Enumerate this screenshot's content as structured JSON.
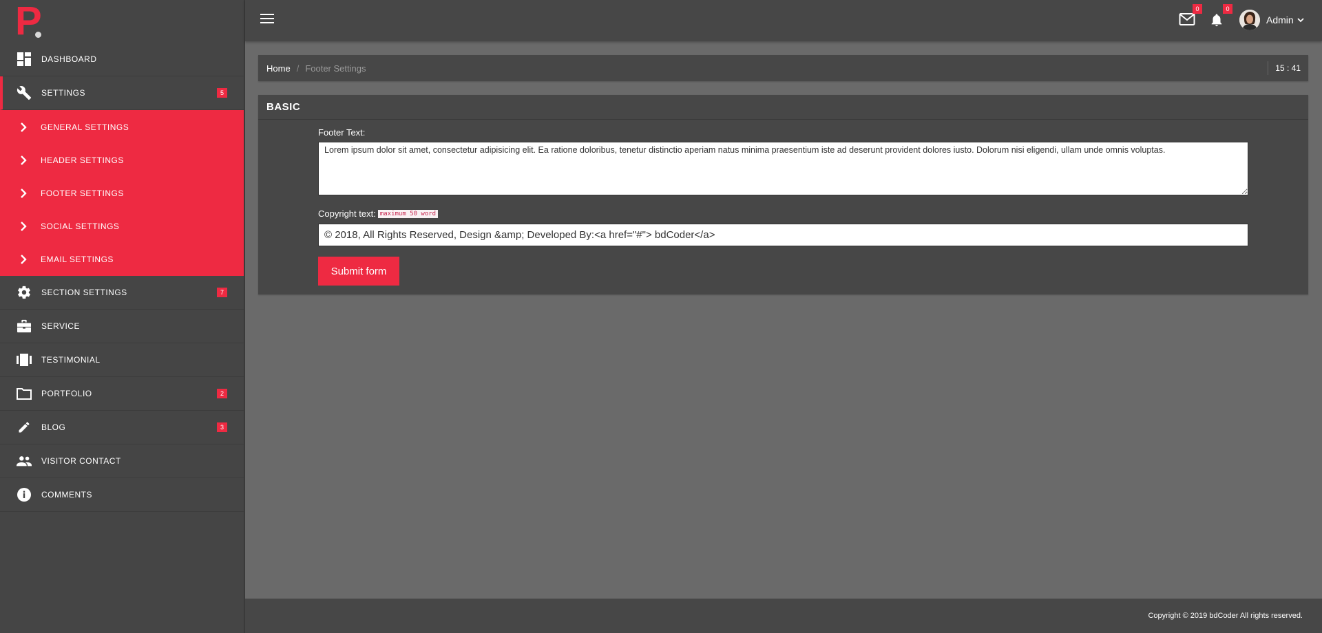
{
  "sidebar": {
    "logo": "P",
    "items": [
      {
        "label": "DASHBOARD",
        "icon": "dashboard-icon"
      },
      {
        "label": "SETTINGS",
        "icon": "wrench-icon",
        "badge": "5",
        "active": true
      },
      {
        "label": "SECTION SETTINGS",
        "icon": "gear-icon",
        "badge": "7"
      },
      {
        "label": "SERVICE",
        "icon": "briefcase-icon"
      },
      {
        "label": "TESTIMONIAL",
        "icon": "carousel-icon"
      },
      {
        "label": "PORTFOLIO",
        "icon": "folder-icon",
        "badge": "2"
      },
      {
        "label": "BLOG",
        "icon": "pencil-icon",
        "badge": "3"
      },
      {
        "label": "VISITOR CONTACT",
        "icon": "people-icon"
      },
      {
        "label": "COMMENTS",
        "icon": "info-icon"
      }
    ],
    "submenu": [
      {
        "label": "GENERAL SETTINGS"
      },
      {
        "label": "HEADER SETTINGS"
      },
      {
        "label": "FOOTER SETTINGS"
      },
      {
        "label": "SOCIAL SETTINGS"
      },
      {
        "label": "EMAIL SETTINGS"
      }
    ]
  },
  "topbar": {
    "mail_count": "0",
    "notification_count": "0",
    "user_name": "Admin"
  },
  "breadcrumb": {
    "home": "Home",
    "separator": "/",
    "current": "Footer Settings",
    "time": "15 : 41"
  },
  "card": {
    "title": "BASIC",
    "footer_label": "Footer Text:",
    "footer_value": "Lorem ipsum dolor sit amet, consectetur adipisicing elit. Ea ratione doloribus, tenetur distinctio aperiam natus minima praesentium iste ad deserunt provident dolores iusto. Dolorum nisi eligendi, ullam unde omnis voluptas.",
    "copyright_label": "Copyright text:",
    "copyright_hint": "maximum 50 word",
    "copyright_value": "© 2018, All Rights Reserved, Design &amp; Developed By:<a href=\"#\"> bdCoder</a>",
    "submit_label": "Submit form"
  },
  "footer": {
    "text": "Copyright © 2019 bdCoder All rights reserved."
  },
  "colors": {
    "accent": "#ee2a42",
    "sidebar_bg": "#454545",
    "content_bg": "#6a6a6a"
  }
}
